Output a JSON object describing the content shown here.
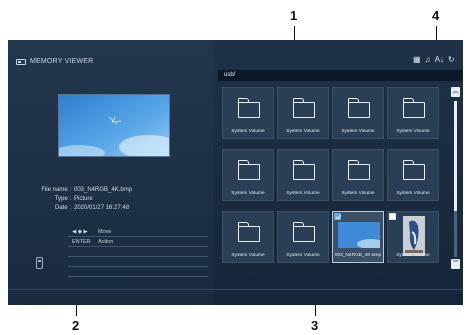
{
  "callouts": [
    "1",
    "2",
    "3",
    "4"
  ],
  "app": {
    "title": "MEMORY VIEWER",
    "icon": "memory-card-icon"
  },
  "path": "usb/",
  "file_info": {
    "labels": [
      "File name :",
      "Type :",
      "Date :"
    ],
    "values": [
      "003_N4RGB_4K.bmp",
      "Picture",
      "2020/01/27 16:27:48"
    ]
  },
  "operations": [
    {
      "key": "◀ ◆ ▶",
      "action": "Move"
    },
    {
      "key": "ENTER",
      "action": "Action"
    },
    {
      "key": "",
      "action": ""
    },
    {
      "key": "",
      "action": ""
    },
    {
      "key": "",
      "action": ""
    }
  ],
  "top_icons": [
    "view-mode-icon",
    "music-note-icon",
    "sort-az-icon",
    "repeat-icon"
  ],
  "top_icon_glyphs": [
    "▦",
    "♫",
    "A↓",
    "↻"
  ],
  "grid": [
    {
      "label": "System Volume",
      "kind": "folder"
    },
    {
      "label": "System Volume",
      "kind": "folder"
    },
    {
      "label": "System Volume",
      "kind": "folder"
    },
    {
      "label": "System Volume",
      "kind": "folder"
    },
    {
      "label": "System Volume",
      "kind": "folder"
    },
    {
      "label": "System Volume",
      "kind": "folder"
    },
    {
      "label": "System Volume",
      "kind": "folder"
    },
    {
      "label": "System Volume",
      "kind": "folder"
    },
    {
      "label": "System Volume",
      "kind": "folder"
    },
    {
      "label": "System Volume",
      "kind": "folder"
    },
    {
      "label": "003_N4RGB_4K.bmp",
      "kind": "image-sky",
      "checked": true,
      "focused": true
    },
    {
      "label": "System Volume",
      "kind": "image-bird",
      "checked": false
    }
  ],
  "scroll": {
    "up": "︽",
    "down": "︾"
  }
}
